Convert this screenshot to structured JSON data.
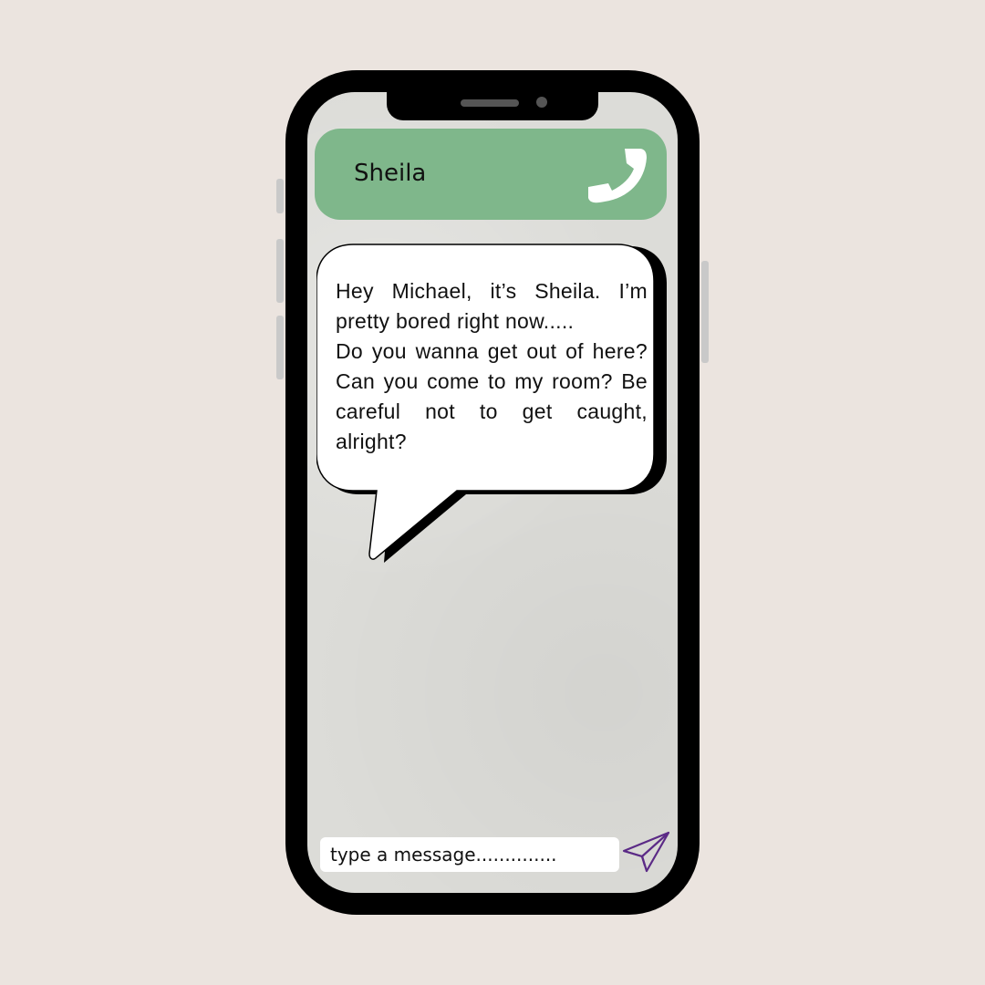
{
  "chat": {
    "contact_name": "Sheila",
    "message_lines": [
      "Hey Michael, it’s Sheila. I’m pretty bored right now.....",
      "Do you wanna get out of here? Can you come to my room? Be careful not to get caught, alright?"
    ]
  },
  "composer": {
    "placeholder": "type a message.............."
  },
  "icons": {
    "call": "phone-icon",
    "send": "paper-plane-icon"
  },
  "colors": {
    "background": "#ebe4df",
    "header": "#7fb78b",
    "send_icon": "#5b2a86"
  }
}
